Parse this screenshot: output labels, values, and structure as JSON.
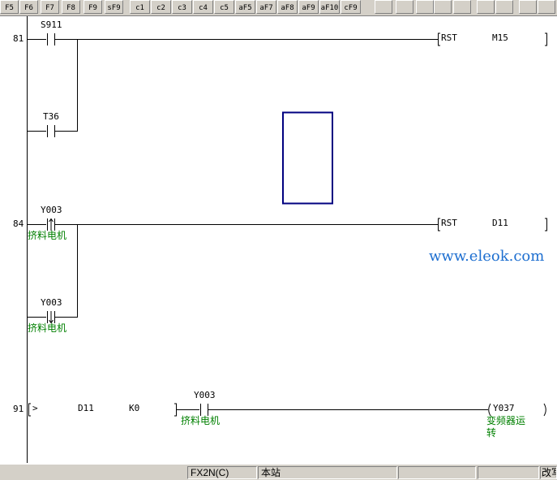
{
  "toolbar": {
    "fkeys": [
      "F5",
      "F6",
      "F7",
      "F8",
      "F9",
      "sF9",
      "c1",
      "c2",
      "c3",
      "c4",
      "c5",
      "aF5",
      "aF7",
      "aF8",
      "aF9",
      "aF10",
      "cF9"
    ]
  },
  "ladder": {
    "rungs": [
      {
        "step": "81",
        "contacts": [
          {
            "device": "S911",
            "comment": ""
          },
          {
            "device": "T36",
            "comment": ""
          }
        ],
        "instruction": {
          "op": "RST",
          "operand": "M15"
        }
      },
      {
        "step": "84",
        "contacts": [
          {
            "device": "Y003",
            "comment": "挤料电机"
          },
          {
            "device": "Y003",
            "comment": "挤料电机"
          }
        ],
        "instruction": {
          "op": "RST",
          "operand": "D11"
        }
      },
      {
        "step": "91",
        "compare": {
          "op": ">",
          "s1": "D11",
          "s2": "K0"
        },
        "contact": {
          "device": "Y003",
          "comment": "挤料电机"
        },
        "coil": {
          "device": "Y037",
          "comment_line1": "变频器运",
          "comment_line2": "转"
        }
      }
    ]
  },
  "watermark": "www.eleok.com",
  "status": {
    "plc": "FX2N(C)",
    "station": "本站",
    "mode": "改写"
  },
  "colors": {
    "comment": "#008000",
    "cursor": "#000080",
    "watermark": "#1e6fd0"
  }
}
